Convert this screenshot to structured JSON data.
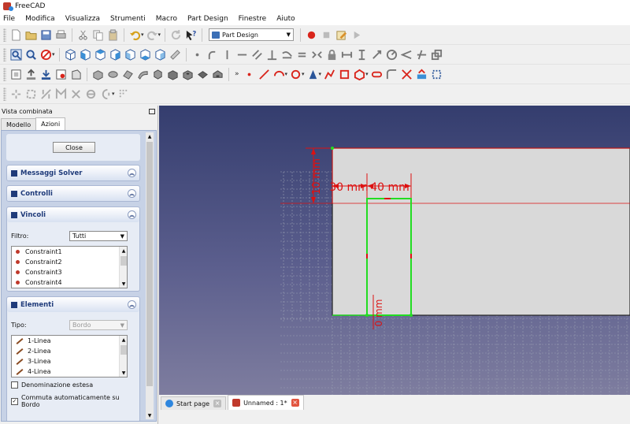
{
  "app": {
    "title": "FreeCAD"
  },
  "menu": [
    "File",
    "Modifica",
    "Visualizza",
    "Strumenti",
    "Macro",
    "Part Design",
    "Finestre",
    "Aiuto"
  ],
  "workbench": {
    "selected": "Part Design"
  },
  "combo_view": {
    "title": "Vista combinata",
    "tabs": [
      "Modello",
      "Azioni"
    ],
    "active_tab": "Azioni",
    "close_label": "Close",
    "solver_messages": {
      "title": "Messaggi Solver"
    },
    "checks": {
      "title": "Controlli"
    },
    "constraints": {
      "title": "Vincoli",
      "filter_label": "Filtro:",
      "filter_value": "Tutti",
      "items": [
        "Constraint1",
        "Constraint2",
        "Constraint3",
        "Constraint4"
      ]
    },
    "elements": {
      "title": "Elementi",
      "type_label": "Tipo:",
      "type_value": "Bordo",
      "items": [
        "1-Linea",
        "2-Linea",
        "3-Linea",
        "4-Linea"
      ],
      "extended_naming": {
        "label": "Denominazione estesa",
        "checked": false
      },
      "auto_switch": {
        "label": "Commuta automaticamente su Bordo",
        "checked": true
      }
    }
  },
  "sketch": {
    "dim_left": "30 mm",
    "dim_right": "40 mm",
    "dim_height": "10 mm",
    "dim_bottom": "0 mm",
    "colors": {
      "geometry": "#22dd22",
      "constraint": "#dd1111",
      "face": "#d9d9d9"
    }
  },
  "documents": [
    {
      "label": "Start page",
      "active": false
    },
    {
      "label": "Unnamed : 1*",
      "active": true
    }
  ]
}
